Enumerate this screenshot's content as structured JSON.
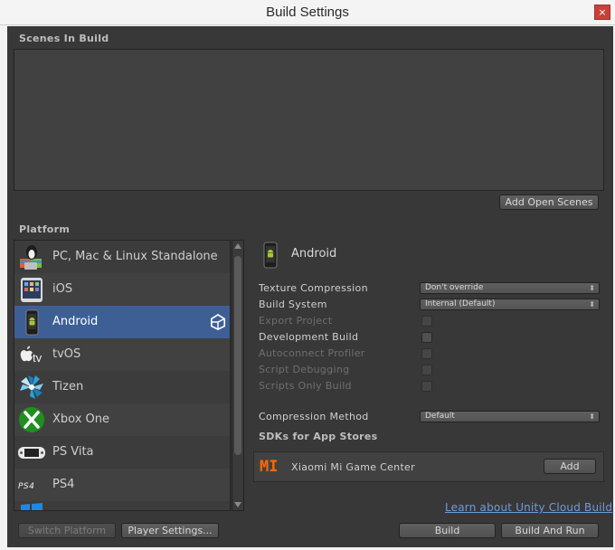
{
  "window": {
    "title": "Build Settings",
    "close_glyph": "×"
  },
  "scenes": {
    "header": "Scenes In Build",
    "add_open_scenes_label": "Add Open Scenes"
  },
  "platforms": {
    "header": "Platform",
    "items": [
      {
        "label": "PC, Mac & Linux Standalone",
        "icon": "pc-mac-linux-icon",
        "selected": false
      },
      {
        "label": "iOS",
        "icon": "ios-device-icon",
        "selected": false
      },
      {
        "label": "Android",
        "icon": "android-phone-icon",
        "selected": true
      },
      {
        "label": "tvOS",
        "icon": "apple-tv-icon",
        "selected": false
      },
      {
        "label": "Tizen",
        "icon": "tizen-icon",
        "selected": false
      },
      {
        "label": "Xbox One",
        "icon": "xbox-icon",
        "selected": false
      },
      {
        "label": "PS Vita",
        "icon": "ps-vita-icon",
        "selected": false
      },
      {
        "label": "PS4",
        "icon": "ps4-icon",
        "selected": false
      }
    ],
    "switch_platform_label": "Switch Platform",
    "player_settings_label": "Player Settings..."
  },
  "selected_platform": {
    "name": "Android",
    "texture_compression": {
      "label": "Texture Compression",
      "value": "Don't override"
    },
    "build_system": {
      "label": "Build System",
      "value": "Internal (Default)"
    },
    "export_project": {
      "label": "Export Project",
      "enabled": false,
      "checked": false
    },
    "development_build": {
      "label": "Development Build",
      "enabled": true,
      "checked": false
    },
    "autoconnect_profiler": {
      "label": "Autoconnect Profiler",
      "enabled": false,
      "checked": false
    },
    "script_debugging": {
      "label": "Script Debugging",
      "enabled": false,
      "checked": false
    },
    "scripts_only_build": {
      "label": "Scripts Only Build",
      "enabled": false,
      "checked": false
    },
    "compression_method": {
      "label": "Compression Method",
      "value": "Default"
    },
    "sdks_header": "SDKs for App Stores",
    "sdk": {
      "name": "Xiaomi Mi Game Center",
      "logo_text": "MI",
      "add_label": "Add"
    }
  },
  "footer": {
    "cloud_link": "Learn about Unity Cloud Build",
    "build_label": "Build",
    "build_and_run_label": "Build And Run"
  },
  "colors": {
    "panel_bg": "#383838",
    "selected_row": "#3e5f96",
    "link": "#6d9be0",
    "close_button": "#c7413a",
    "xiaomi_orange": "#ff6900"
  }
}
